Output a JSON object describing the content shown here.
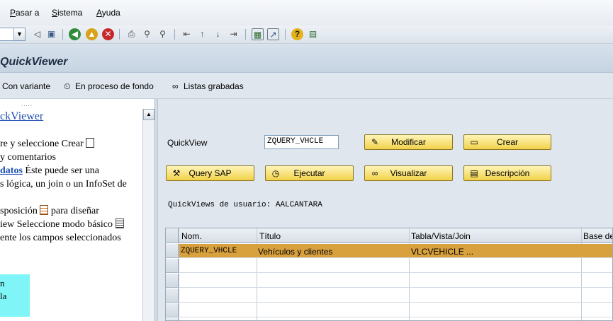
{
  "menubar": {
    "items": [
      {
        "label": "Pasar a",
        "accel": "P"
      },
      {
        "label": "Sistema",
        "accel": "S"
      },
      {
        "label": "Ayuda",
        "accel": "A"
      }
    ]
  },
  "toolbar": {
    "icons": [
      "back-arrow-icon",
      "save-icon",
      "green-back-icon",
      "exit-icon",
      "cancel-icon",
      "print-icon",
      "find-icon",
      "find-next-icon",
      "first-page-icon",
      "prev-page-icon",
      "next-page-icon",
      "last-page-icon",
      "create-session-icon",
      "shortcut-icon",
      "help-icon",
      "layout-icon"
    ]
  },
  "title": "QuickViewer",
  "app_toolbar": {
    "with_variant": "Con variante",
    "background": "En proceso de fondo",
    "saved_lists": "Listas grabadas"
  },
  "left_panel": {
    "grip": ".....",
    "heading": "ckViewer",
    "line1": "re y seleccione Crear",
    "line2": "y comentarios",
    "line3_link": "datos",
    "line3_rest": " Éste puede ser una",
    "line4": "s lógica, un join o un InfoSet de",
    "line5_pre": "sposición",
    "line5_post": " para diseñar",
    "line6": "iew Seleccione modo básico",
    "line7": "ente los campos seleccionados",
    "cyan_line1": "n",
    "cyan_line2": "la"
  },
  "form": {
    "quickview_label": "QuickView",
    "quickview_value": "ZQUERY_VHCLE",
    "buttons": {
      "modify": "Modificar",
      "create": "Crear",
      "query_sap": "Query SAP",
      "execute": "Ejecutar",
      "display": "Visualizar",
      "description": "Descripción"
    },
    "user_quickviews": "QuickViews de usuario: AALCANTARA"
  },
  "table": {
    "columns": [
      "Nom.",
      "Título",
      "Tabla/Vista/Join",
      "Base de"
    ],
    "rows": [
      {
        "name": "ZQUERY_VHCLE",
        "title": "Vehículos y clientes",
        "source": "VLCVEHICLE ...",
        "base": ""
      }
    ]
  }
}
